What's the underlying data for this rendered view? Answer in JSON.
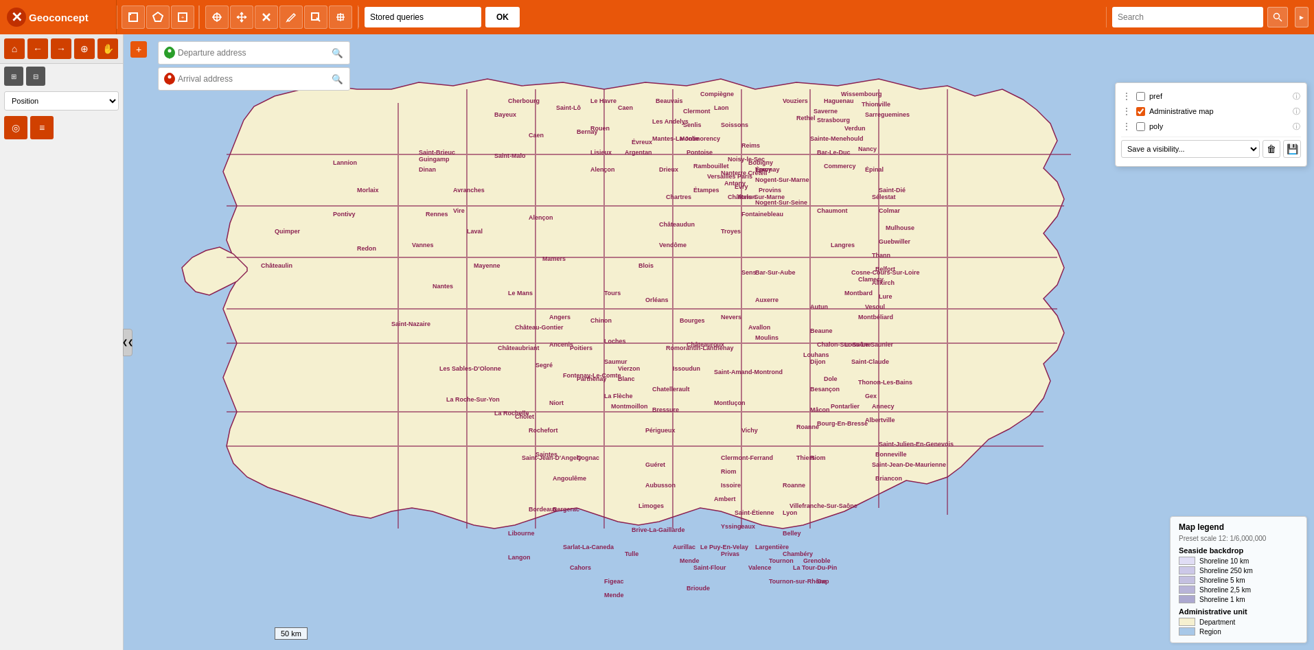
{
  "header": {
    "logo": {
      "icon": "✕",
      "text": "Geoconcept"
    },
    "toolbar_left": {
      "buttons": [
        {
          "id": "select-rect",
          "icon": "⬜",
          "title": "Rectangle select"
        },
        {
          "id": "select-poly",
          "icon": "⬡",
          "title": "Polygon select"
        },
        {
          "id": "select-extend",
          "icon": "⊞",
          "title": "Extend select"
        }
      ]
    },
    "toolbar_draw": {
      "buttons": [
        {
          "id": "draw-point",
          "icon": "⊕",
          "title": "Draw point"
        },
        {
          "id": "draw-move",
          "icon": "✛",
          "title": "Move"
        },
        {
          "id": "draw-delete",
          "icon": "✕",
          "title": "Delete"
        },
        {
          "id": "draw-edit",
          "icon": "✏",
          "title": "Edit"
        },
        {
          "id": "draw-select",
          "icon": "⊞",
          "title": "Select"
        },
        {
          "id": "draw-drag",
          "icon": "✤",
          "title": "Drag"
        }
      ]
    },
    "stored_queries": {
      "label": "Stored queries",
      "placeholder": "Stored queries",
      "ok_label": "OK"
    },
    "search": {
      "placeholder": "Search",
      "label": "Search"
    }
  },
  "sidebar": {
    "nav": {
      "home_label": "Home",
      "back_label": "Back",
      "forward_label": "Forward",
      "locate_label": "Locate",
      "hand_label": "Hand tool",
      "zoom_in_label": "+",
      "zoom_out_label": "-"
    },
    "position": {
      "label": "Position",
      "placeholder": "Position"
    },
    "layers": {
      "locate_label": "Locate layer",
      "layers_label": "Layers"
    }
  },
  "map": {
    "route": {
      "departure_placeholder": "Departure address",
      "arrival_placeholder": "Arrival address"
    },
    "scale": "50 km",
    "expand_icon": "+"
  },
  "visibility_panel": {
    "layers": [
      {
        "id": "pref",
        "label": "pref",
        "checked": false
      },
      {
        "id": "admin-map",
        "label": "Administrative map",
        "checked": true
      },
      {
        "id": "poly",
        "label": "poly",
        "checked": false
      }
    ],
    "save_label": "Save a visibility...",
    "save_options": [
      "Save a visibility..."
    ],
    "delete_icon": "🗑",
    "save_icon": "💾"
  },
  "map_legend": {
    "title": "Map legend",
    "preset_scale": "Preset scale 12: 1/6,000,000",
    "sections": [
      {
        "title": "Seaside backdrop",
        "items": [
          {
            "color": "#e8e4f0",
            "label": "Shoreline 10 km"
          },
          {
            "color": "#d4cce8",
            "label": "Shoreline 250 km"
          },
          {
            "color": "#c8c0e0",
            "label": "Shoreline 5 km"
          },
          {
            "color": "#bcb4d8",
            "label": "Shoreline 2,5 km"
          },
          {
            "color": "#b0a8d0",
            "label": "Shoreline 1 km"
          }
        ]
      },
      {
        "title": "Administrative unit",
        "items": [
          {
            "color": "#f5f0d0",
            "label": "Department"
          },
          {
            "color": "#a8c8e8",
            "label": "Region"
          }
        ]
      }
    ]
  },
  "icons": {
    "search": "🔍",
    "chevron_down": "▾",
    "chevron_left": "❮",
    "home": "⌂",
    "back": "←",
    "forward": "→",
    "locate": "◎",
    "hand": "✋",
    "layers": "≡",
    "target": "⊕",
    "delete": "🗑",
    "save": "💾",
    "info": "ⓘ",
    "menu": "⋮",
    "collapse": "❮❮"
  }
}
